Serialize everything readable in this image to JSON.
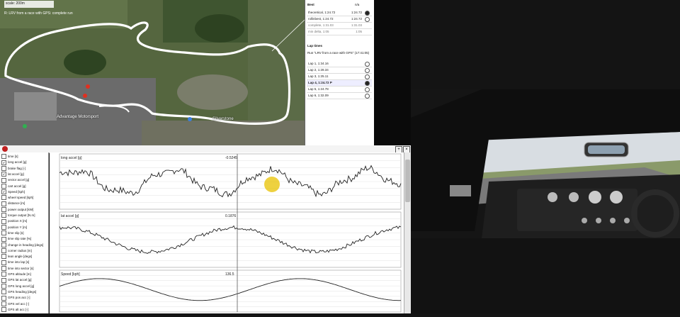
{
  "map": {
    "scale_label": "scale: 200m",
    "title": "R: LRV from a race with GPS: complete run",
    "labels": [
      "Advantage Motorsport",
      "Silverstone"
    ]
  },
  "best": {
    "header": "Best",
    "header2": "n/a",
    "rows": [
      {
        "label": "theoretical, 1:24.72",
        "value": "1:24.72",
        "selected": true
      },
      {
        "label": "rollinbest, 1:24.72",
        "value": "1:24.72",
        "selected": false
      },
      {
        "label": "complete, 1:31.03",
        "value": "1:31.03",
        "selected": false
      },
      {
        "label": "min delta, 1:05",
        "value": "1:05",
        "selected": false
      }
    ]
  },
  "laps": {
    "header": "Lap times",
    "source": "Run \"LRV from a race with GPS\" (17:41:05)",
    "items": [
      {
        "label": "Lap 1, 1:34.16",
        "selected": false,
        "bold": false
      },
      {
        "label": "Lap 2, 1:28.34",
        "selected": false,
        "bold": false
      },
      {
        "label": "Lap 3, 1:25.11",
        "selected": false,
        "bold": false
      },
      {
        "label": "Lap 4, 1:24.72 P",
        "selected": true,
        "bold": true
      },
      {
        "label": "Lap 5, 1:24.78",
        "selected": false,
        "bold": false
      },
      {
        "label": "Lap 6, 1:32.09",
        "selected": false,
        "bold": false
      }
    ]
  },
  "channels": [
    {
      "label": "time [s]",
      "checked": false
    },
    {
      "label": "long accel [g]",
      "checked": true
    },
    {
      "label": "brake flag [-]",
      "checked": false
    },
    {
      "label": "lat accel [g]",
      "checked": true
    },
    {
      "label": "vector accel [g]",
      "checked": false
    },
    {
      "label": "cart accel [g]",
      "checked": false
    },
    {
      "label": "Speed [kph]",
      "checked": true
    },
    {
      "label": "wheel speed [kph]",
      "checked": false
    },
    {
      "label": "distance [m]",
      "checked": false
    },
    {
      "label": "power output [kW]",
      "checked": false
    },
    {
      "label": "torque output [N.m]",
      "checked": false
    },
    {
      "label": "position X [m]",
      "checked": false
    },
    {
      "label": "position Y [m]",
      "checked": false
    },
    {
      "label": "time slip [s]",
      "checked": false
    },
    {
      "label": "time slip rate [%]",
      "checked": false
    },
    {
      "label": "change in heading [degs]",
      "checked": false
    },
    {
      "label": "corner radius [m]",
      "checked": false
    },
    {
      "label": "lean angle [degs]",
      "checked": false
    },
    {
      "label": "time into lap [s]",
      "checked": false
    },
    {
      "label": "time into sector [s]",
      "checked": false
    },
    {
      "label": "GPS altitude [m]",
      "checked": false
    },
    {
      "label": "GPS lat accel [g]",
      "checked": false
    },
    {
      "label": "GPS long accel [g]",
      "checked": false
    },
    {
      "label": "GPS heading [degs]",
      "checked": false
    },
    {
      "label": "GPS pos acc [-]",
      "checked": false
    },
    {
      "label": "GPS vel acc [-]",
      "checked": false
    },
    {
      "label": "GPS alt acc [-]",
      "checked": false
    }
  ],
  "graphs": [
    {
      "label": "long accel [g]",
      "cursor": "-0.5245"
    },
    {
      "label": "lat accel [g]",
      "cursor": "0.1876"
    },
    {
      "label": "Speed [kph]",
      "cursor": "136.5"
    }
  ],
  "colors": {
    "accent": "#e8c200",
    "track": "#ffffff"
  }
}
